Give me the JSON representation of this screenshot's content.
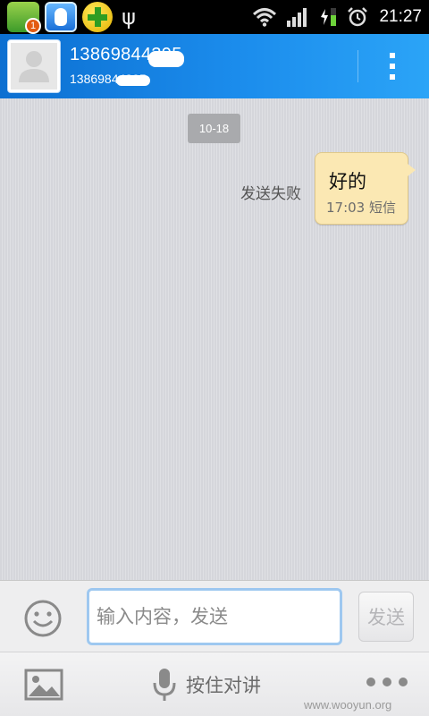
{
  "status_bar": {
    "notification_badge": "1",
    "usb_glyph": "ψ",
    "time": "21:27",
    "icons": [
      "clover-app-icon",
      "qq-icon",
      "plus-app-icon",
      "usb-icon",
      "wifi-icon",
      "signal-icon",
      "battery-charging-icon",
      "alarm-icon"
    ]
  },
  "header": {
    "contact_name": "13869844395",
    "contact_number": "13869844395",
    "accent_color": "#1b8cec"
  },
  "chat": {
    "date_label": "10-18",
    "messages": [
      {
        "text": "好的",
        "time": "17:03",
        "channel": "短信",
        "status": "发送失败",
        "direction": "outgoing"
      }
    ]
  },
  "input_bar": {
    "placeholder": "输入内容，发送",
    "send_label": "发送"
  },
  "toolbar": {
    "push_to_talk_label": "按住对讲"
  },
  "watermark": "www.wooyun.org"
}
